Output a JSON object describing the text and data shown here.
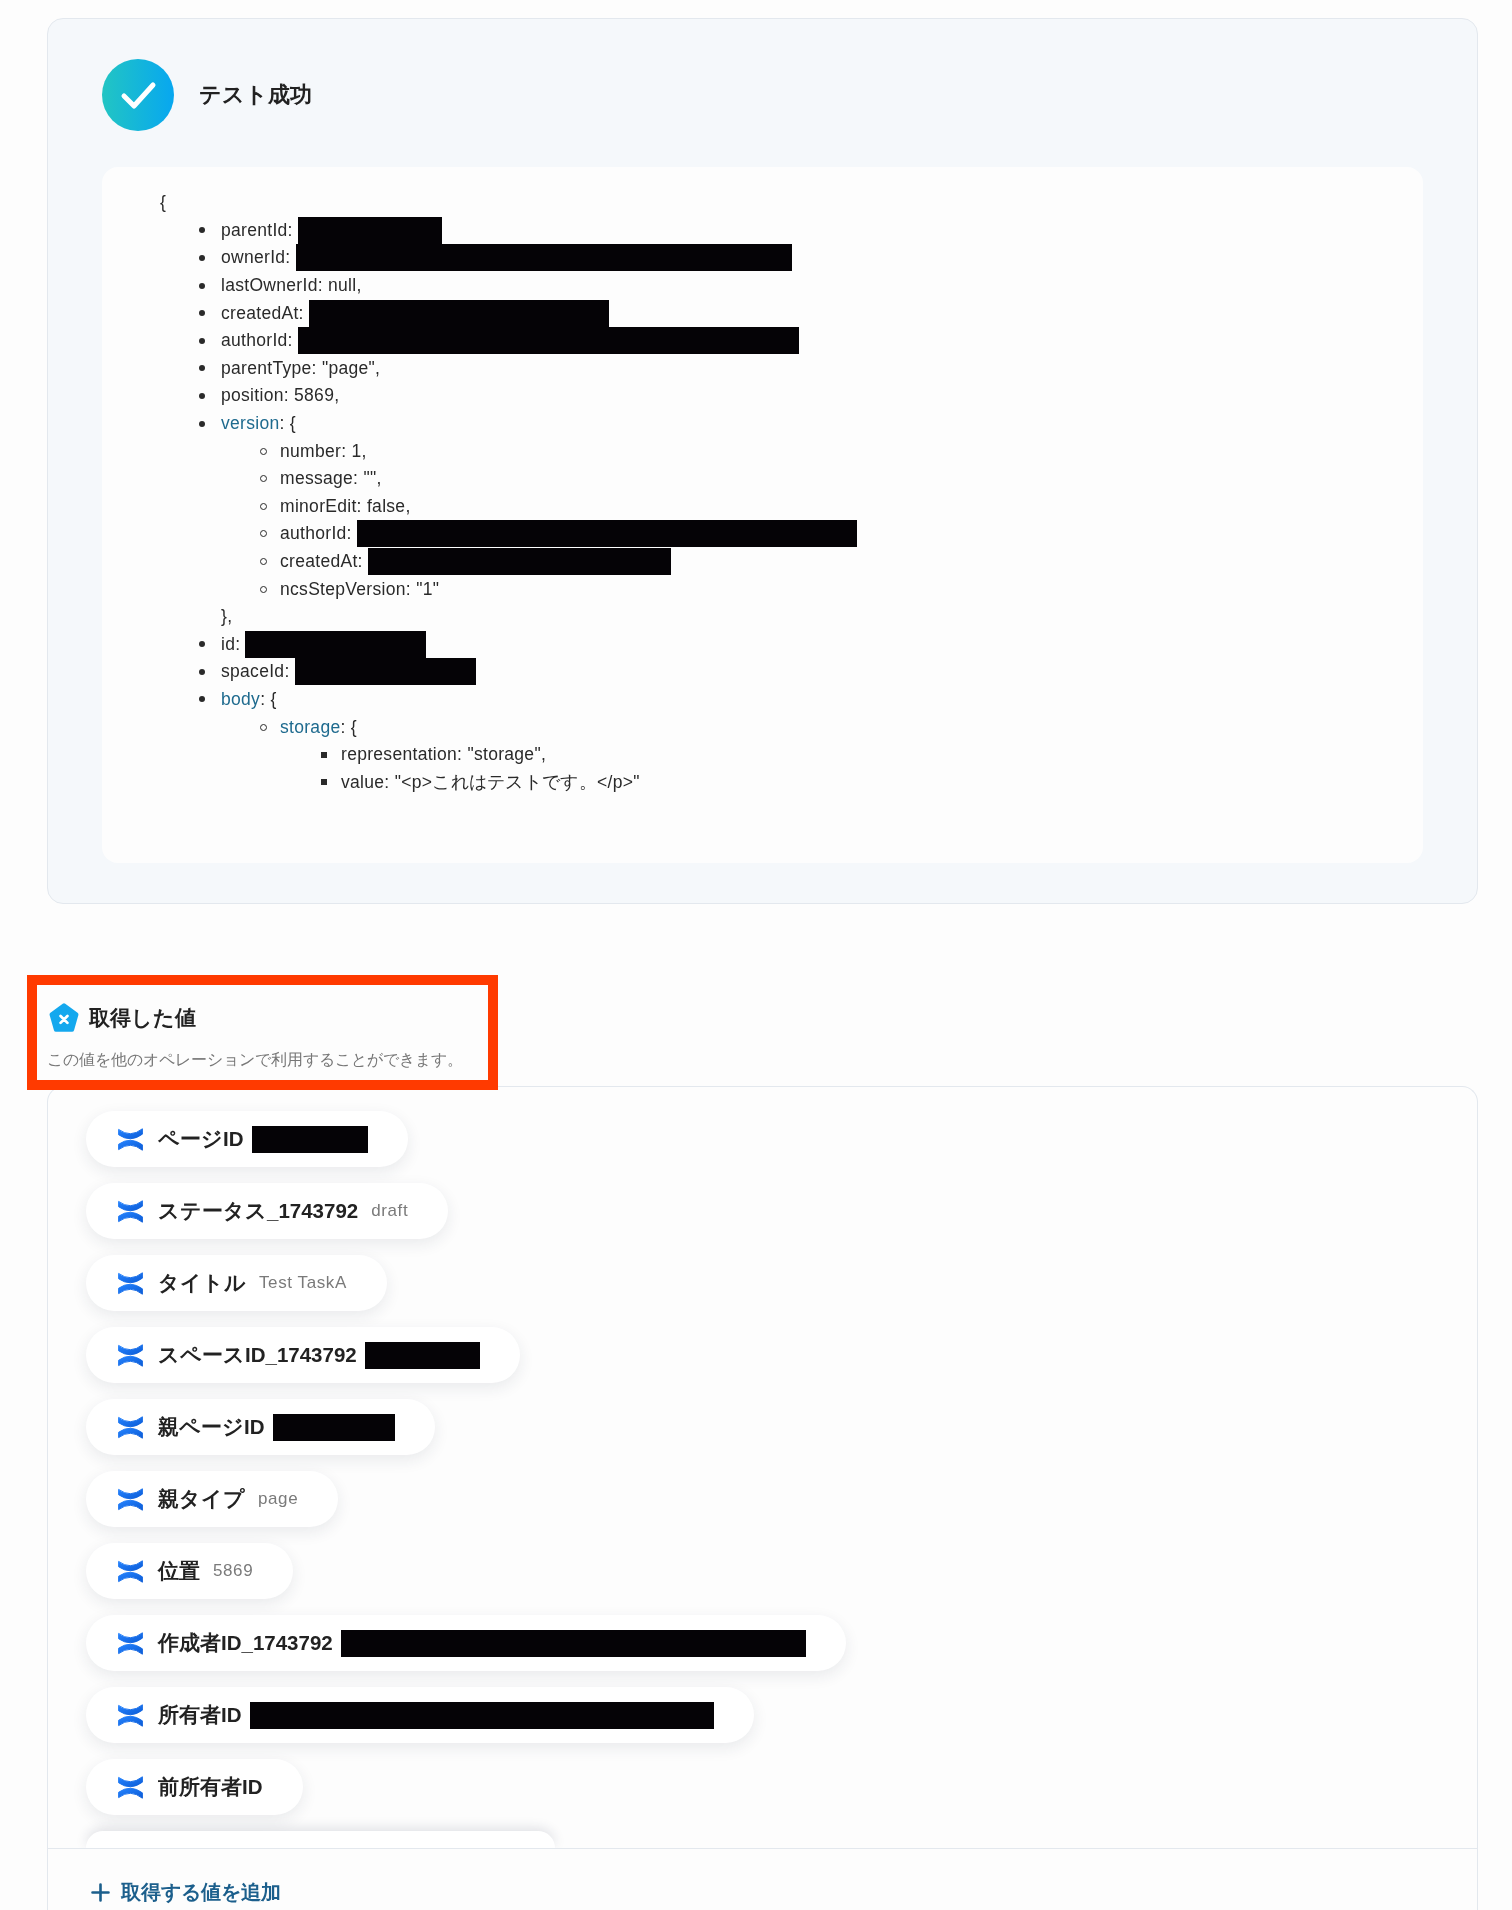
{
  "test_result": {
    "passed": true,
    "title": "テスト成功",
    "output": {
      "open": "{",
      "lines": [
        {
          "kind": "field",
          "text": "parentId:",
          "redacted": true
        },
        {
          "kind": "field",
          "text": "ownerId:",
          "redacted": true
        },
        {
          "kind": "field",
          "text": "lastOwnerId: null,",
          "redacted": false
        },
        {
          "kind": "field",
          "text": "createdAt:",
          "redacted": true
        },
        {
          "kind": "field",
          "text": "authorId:",
          "redacted": true
        },
        {
          "kind": "field",
          "text": "parentType: \"page\",",
          "redacted": false
        },
        {
          "kind": "field",
          "text": "position: 5869,",
          "redacted": false
        },
        {
          "kind": "object",
          "key": "version",
          "open": ": {",
          "close": "},",
          "children": [
            {
              "kind": "field",
              "text": "number: 1,",
              "redacted": false
            },
            {
              "kind": "field",
              "text": "message: \"\",",
              "redacted": false
            },
            {
              "kind": "field",
              "text": "minorEdit: false,",
              "redacted": false
            },
            {
              "kind": "field",
              "text": "authorId:",
              "redacted": true
            },
            {
              "kind": "field",
              "text": "createdAt:",
              "redacted": true
            },
            {
              "kind": "field",
              "text": "ncsStepVersion: \"1\"",
              "redacted": false
            }
          ]
        },
        {
          "kind": "field",
          "text": "id:",
          "redacted": true
        },
        {
          "kind": "field",
          "text": "spaceId:",
          "redacted": true
        },
        {
          "kind": "object",
          "key": "body",
          "open": ": {",
          "children": [
            {
              "kind": "object",
              "key": "storage",
              "open": ": {",
              "children": [
                {
                  "kind": "field",
                  "text": "representation: \"storage\",",
                  "redacted": false
                },
                {
                  "kind": "field",
                  "text": "value: \"<p>これはテストです。</p>\"",
                  "redacted": false
                }
              ]
            }
          ]
        }
      ]
    }
  },
  "values_section": {
    "title": "取得した値",
    "description": "この値を他のオペレーションで利用することができます。",
    "highlighted": true,
    "items": [
      {
        "label": "ページID",
        "redacted": true
      },
      {
        "label": "ステータス_1743792",
        "value": "draft",
        "redacted": false
      },
      {
        "label": "タイトル",
        "value": "Test TaskA",
        "redacted": false
      },
      {
        "label": "スペースID_1743792",
        "redacted": true
      },
      {
        "label": "親ページID",
        "redacted": true
      },
      {
        "label": "親タイプ",
        "value": "page",
        "redacted": false
      },
      {
        "label": "位置",
        "value": "5869",
        "redacted": false
      },
      {
        "label": "作成者ID_1743792",
        "redacted": true
      },
      {
        "label": "所有者ID",
        "redacted": true
      },
      {
        "label": "前所有者ID",
        "redacted": false
      }
    ],
    "more_below": true,
    "add_button": {
      "label": "取得する値を追加"
    }
  }
}
